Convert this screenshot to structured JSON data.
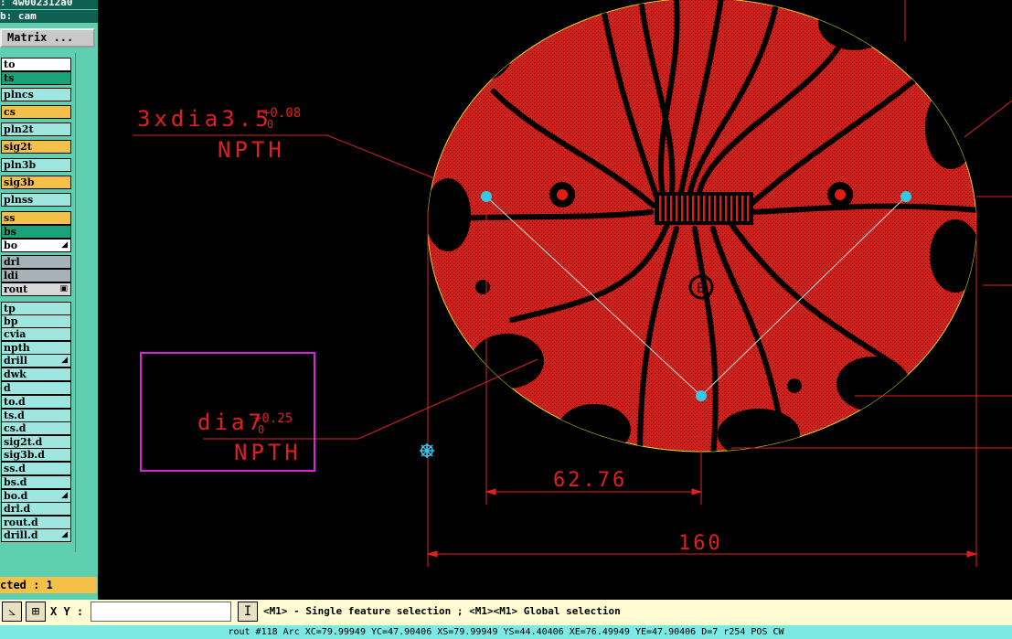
{
  "left_panel": {
    "header_line1": ": 4w002312a0",
    "header_line2": "b: cam",
    "matrix_button": "Matrix ...",
    "layers": [
      {
        "name": "to",
        "color": "#ffffff",
        "mark": ""
      },
      {
        "name": "ts",
        "color": "#1aa37a",
        "mark": ""
      },
      {
        "name": "plncs",
        "color": "#9fe6e0",
        "mark": ""
      },
      {
        "name": "cs",
        "color": "#f5c04a",
        "mark": ""
      },
      {
        "name": "pln2t",
        "color": "#9fe6e0",
        "mark": ""
      },
      {
        "name": "sig2t",
        "color": "#f5c04a",
        "mark": ""
      },
      {
        "name": "pln3b",
        "color": "#9fe6e0",
        "mark": ""
      },
      {
        "name": "sig3b",
        "color": "#f5c04a",
        "mark": ""
      },
      {
        "name": "plnss",
        "color": "#9fe6e0",
        "mark": ""
      },
      {
        "name": "ss",
        "color": "#f5c04a",
        "mark": ""
      },
      {
        "name": "bs",
        "color": "#1aa37a",
        "mark": ""
      },
      {
        "name": "bo",
        "color": "#ffffff",
        "mark": "◢"
      },
      {
        "name": "drl",
        "color": "#a6b2b8",
        "mark": ""
      },
      {
        "name": "ldi",
        "color": "#a6b2b8",
        "mark": ""
      },
      {
        "name": "rout",
        "color": "#d8d8d8",
        "mark": "▣"
      },
      {
        "name": "tp",
        "color": "#9fe6e0",
        "mark": ""
      },
      {
        "name": "bp",
        "color": "#9fe6e0",
        "mark": ""
      },
      {
        "name": "cvia",
        "color": "#9fe6e0",
        "mark": ""
      },
      {
        "name": "npth",
        "color": "#9fe6e0",
        "mark": ""
      },
      {
        "name": "drill",
        "color": "#9fe6e0",
        "mark": "◢"
      },
      {
        "name": "dwk",
        "color": "#9fe6e0",
        "mark": ""
      },
      {
        "name": "d",
        "color": "#9fe6e0",
        "mark": ""
      },
      {
        "name": "to.d",
        "color": "#9fe6e0",
        "mark": ""
      },
      {
        "name": "ts.d",
        "color": "#9fe6e0",
        "mark": ""
      },
      {
        "name": "cs.d",
        "color": "#9fe6e0",
        "mark": ""
      },
      {
        "name": "sig2t.d",
        "color": "#9fe6e0",
        "mark": ""
      },
      {
        "name": "sig3b.d",
        "color": "#9fe6e0",
        "mark": ""
      },
      {
        "name": "ss.d",
        "color": "#9fe6e0",
        "mark": ""
      },
      {
        "name": "bs.d",
        "color": "#9fe6e0",
        "mark": ""
      },
      {
        "name": "bo.d",
        "color": "#9fe6e0",
        "mark": "◢"
      },
      {
        "name": "drl.d",
        "color": "#9fe6e0",
        "mark": ""
      },
      {
        "name": "rout.d",
        "color": "#9fe6e0",
        "mark": ""
      },
      {
        "name": "drill.d",
        "color": "#9fe6e0",
        "mark": "◢"
      }
    ],
    "selected_text": "cted : 1"
  },
  "canvas": {
    "annotation1_line1": "3xdia3.5",
    "annotation1_tol_plus": "+0.08",
    "annotation1_tol_minus": "0",
    "annotation1_line2": "NPTH",
    "annotation2_line1": "dia7",
    "annotation2_tol_plus": "+0.25",
    "annotation2_tol_minus": "0",
    "annotation2_line2": "NPTH",
    "dim_inner": "62.76",
    "dim_outer": "160",
    "board_color": "#e8190f"
  },
  "bottom": {
    "xy_label": "X Y :",
    "xy_value": "",
    "message": "<M1> - Single feature selection ; <M1><M1> Global selection"
  },
  "status": "rout #118 Arc XC=79.99949 YC=47.90406 XS=79.99949 YS=44.40406 XE=76.49949 YE=47.90406 D=7 r254 POS CW"
}
